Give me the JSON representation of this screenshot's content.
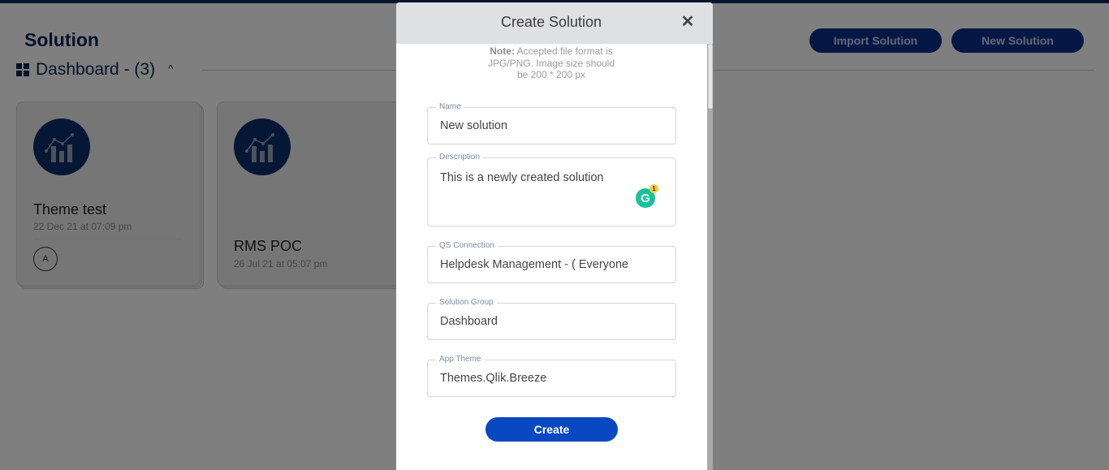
{
  "page": {
    "title": "Solution",
    "buttons": {
      "import": "Import Solution",
      "new": "New Solution"
    },
    "group": {
      "label": "Dashboard - (3)",
      "collapse_icon": "caret-up-icon"
    },
    "cards": [
      {
        "title": "Theme test",
        "date": "22 Dec 21 at 07:09 pm",
        "avatar": "A",
        "icon": "chart-icon"
      },
      {
        "title": "RMS POC",
        "date": "26 Jul 21 at 05:07 pm",
        "icon": "chart-icon"
      }
    ]
  },
  "modal": {
    "title": "Create Solution",
    "close_icon": "close-icon",
    "note_bold": "Note:",
    "note_text": " Accepted file format is JPG/PNG. Image size should be 200 * 200 px",
    "fields": {
      "name": {
        "label": "Name",
        "value": "New solution"
      },
      "description": {
        "label": "Description",
        "value": "This is a newly created solution"
      },
      "qs_connection": {
        "label": "QS Connection",
        "value": "Helpdesk Management - ( Everyone"
      },
      "solution_group": {
        "label": "Solution Group",
        "value": "Dashboard"
      },
      "app_theme": {
        "label": "App Theme",
        "value": "Themes.Qlik.Breeze"
      }
    },
    "grammarly": {
      "letter": "G",
      "count": "1"
    },
    "create_label": "Create"
  },
  "colors": {
    "brand_dark": "#0b2550",
    "primary_button": "#0848c0",
    "grammarly": "#15c39a"
  }
}
